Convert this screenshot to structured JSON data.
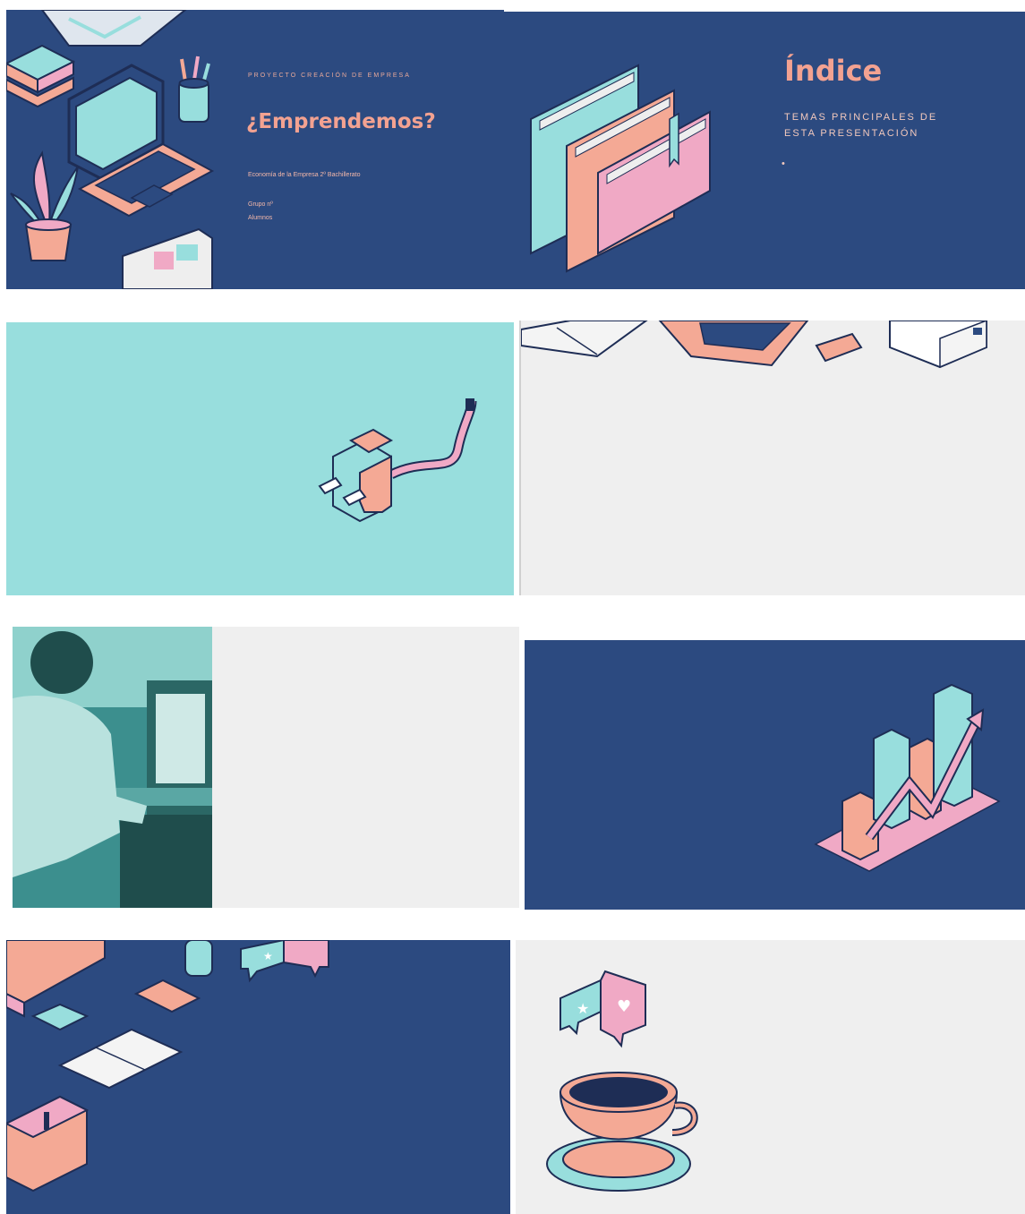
{
  "colors": {
    "navy": "#2c4a80",
    "mint": "#98dedd",
    "salmon": "#f4a995",
    "pink": "#f0a9c5",
    "light_grey": "#efefef",
    "outline": "#1e2d55"
  },
  "slides": [
    {
      "id": "slide-1",
      "kicker": "PROYECTO CREACIÓN DE EMPRESA",
      "title": "¿Emprendemos?",
      "subtitle": "Economía de la Empresa 2º Bachillerato",
      "group": "Grupo nº",
      "students": "Alumnos",
      "icons": [
        "map-icon",
        "books-icon",
        "laptop-icon",
        "pencil-cup-icon",
        "plant-icon",
        "document-icon"
      ]
    },
    {
      "id": "slide-2",
      "title": "Índice",
      "subtitle_line1": "TEMAS PRINCIPALES DE",
      "subtitle_line2": "ESTA PRESENTACIÓN",
      "bullet": "•",
      "icons": [
        "folders-icon"
      ]
    },
    {
      "id": "slide-3",
      "icons": [
        "power-plug-icon"
      ]
    },
    {
      "id": "slide-4",
      "icons": [
        "notebook-icon",
        "laptop-icon",
        "phone-icon",
        "printer-icon"
      ]
    },
    {
      "id": "slide-5",
      "icons": [
        "person-at-computer-photo"
      ]
    },
    {
      "id": "slide-6",
      "icons": [
        "bar-chart-growth-icon"
      ]
    },
    {
      "id": "slide-7",
      "icons": [
        "monitor-icon",
        "phone-icon",
        "open-book-icon",
        "briefcase-icon",
        "chat-bubbles-icon",
        "bottle-icon"
      ]
    },
    {
      "id": "slide-8",
      "icons": [
        "chat-bubbles-icon",
        "coffee-cup-icon"
      ]
    }
  ]
}
